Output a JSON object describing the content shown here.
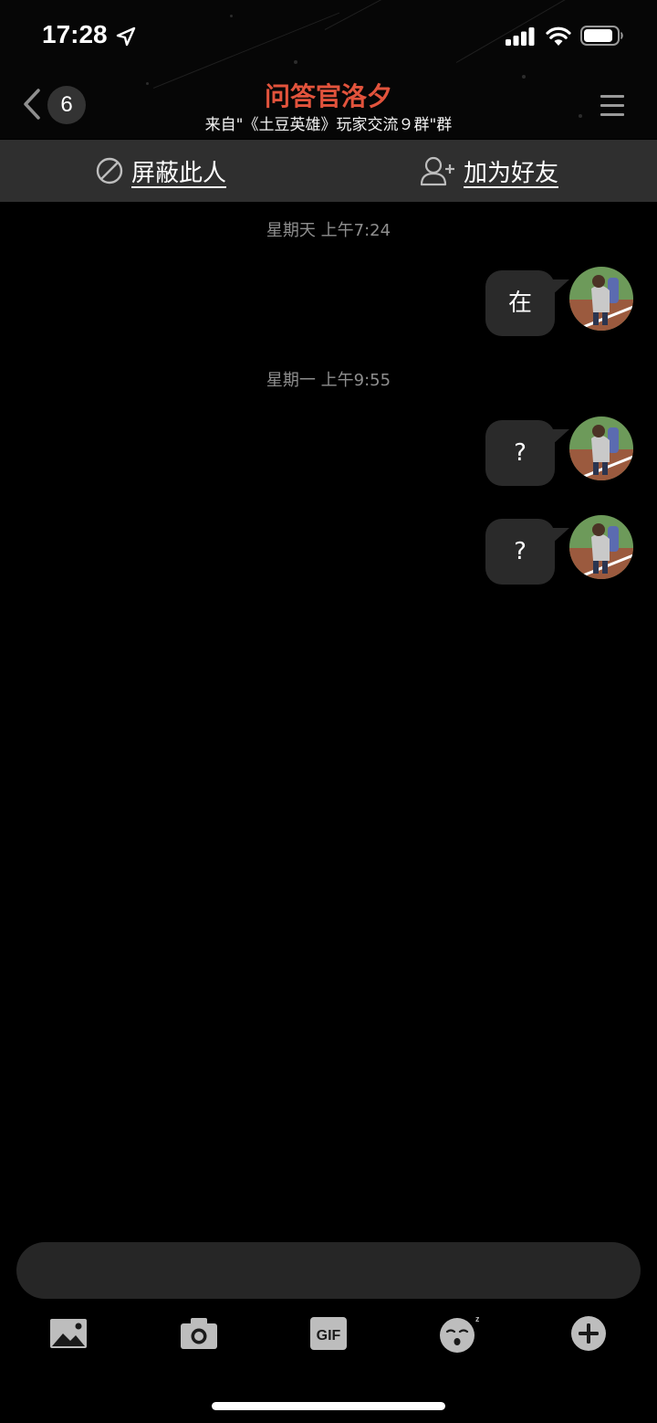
{
  "status_bar": {
    "time": "17:28"
  },
  "nav": {
    "unread_count": "6",
    "title": "问答官洛夕",
    "subtitle": "来自\"《土豆英雄》玩家交流９群\"群"
  },
  "actions": {
    "block_label": "屏蔽此人",
    "add_friend_label": "加为好友"
  },
  "messages": [
    {
      "timestamp": "星期天 上午7:24",
      "text": "在"
    },
    {
      "timestamp": "星期一 上午9:55",
      "text": "?"
    },
    {
      "text": "?"
    }
  ],
  "input": {
    "placeholder": ""
  },
  "toolbar": [
    "image-icon",
    "camera-icon",
    "gif-icon",
    "emoji-icon",
    "plus-icon"
  ],
  "colors": {
    "title": "#e2533c",
    "background": "#000000",
    "bubble": "#2a2a2a",
    "action_bar": "#2f2f2f"
  }
}
